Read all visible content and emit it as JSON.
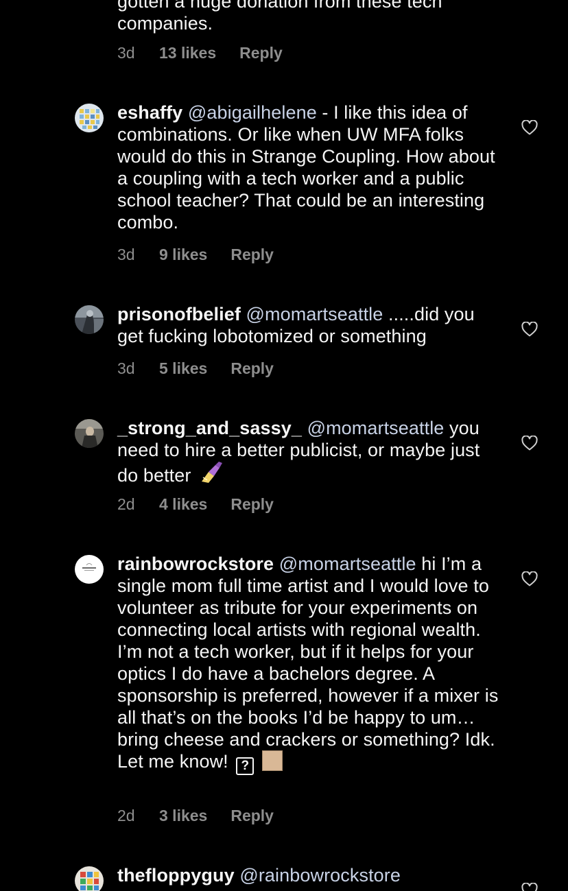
{
  "top_comment": {
    "text_partial": "gotten a huge donation from these tech",
    "text_end": "companies.",
    "time": "3d",
    "likes": "13 likes",
    "reply": "Reply"
  },
  "comments": [
    {
      "username": "eshaffy",
      "mention": "@abigailhelene",
      "text": " - I like this idea of combinations. Or like when UW MFA folks would do this in Strange Coupling. How about a coupling with a tech worker and a public school teacher? That could be an interesting combo.",
      "time": "3d",
      "likes": "9 likes",
      "reply": "Reply"
    },
    {
      "username": "prisonofbelief",
      "mention": "@momartseattle",
      "text": " .....did you get fucking lobotomized or something",
      "time": "3d",
      "likes": "5 likes",
      "reply": "Reply"
    },
    {
      "username": "_strong_and_sassy_",
      "mention": "@momartseattle",
      "text": " you need to hire a better publicist, or maybe just do better",
      "emoji": "nail-polish-emoji",
      "time": "2d",
      "likes": "4 likes",
      "reply": "Reply"
    },
    {
      "username": "rainbowrockstore",
      "mention": "@momartseattle",
      "text": " hi I’m a single mom full time artist and I would love to volunteer as tribute for your experiments on connecting local artists with regional wealth. I’m not a tech worker, but if it helps for your optics I do have a bachelors degree. A sponsorship is preferred, however if a mixer is all that’s on the books I’d be happy to um…bring cheese and crackers or something? Idk. Let me know!",
      "missing_glyph": "?",
      "time": "2d",
      "likes": "3 likes",
      "reply": "Reply"
    },
    {
      "username": "thefloppyguy",
      "mention": "@rainbowrockstore"
    }
  ],
  "icons": {
    "like": "heart-outline-icon"
  },
  "colors": {
    "background": "#000000",
    "text": "#f5f5f5",
    "meta": "#8e8e8e",
    "mention": "#c8d2e6",
    "swatch": "#d9b896"
  }
}
